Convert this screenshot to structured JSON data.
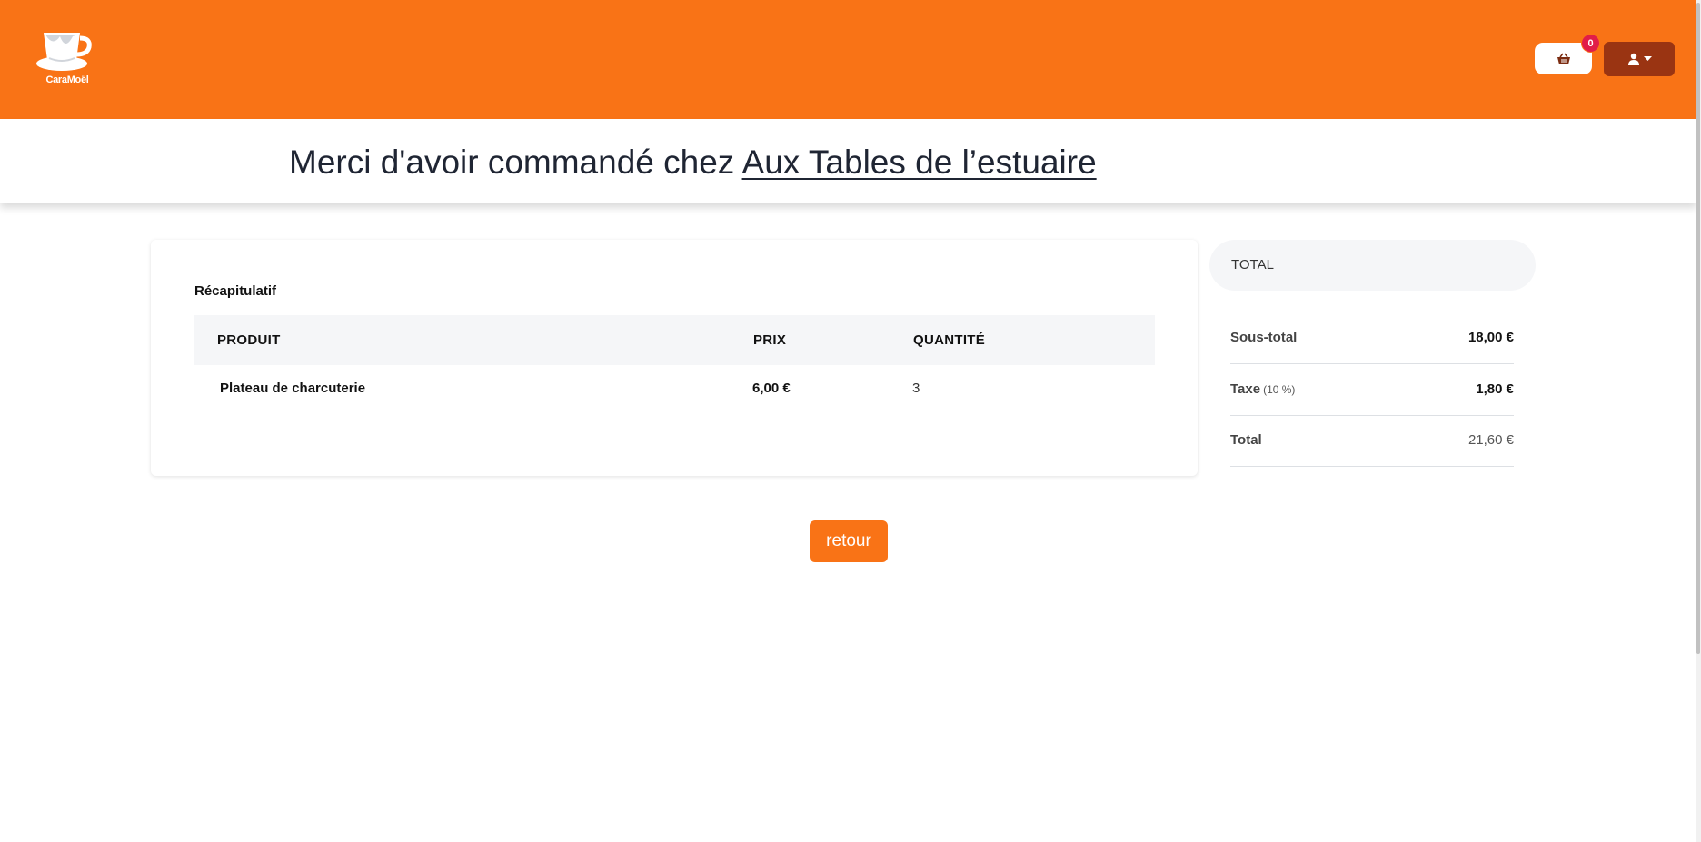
{
  "header": {
    "logo_text": "CaraMoël",
    "cart_count": "0",
    "cart_icon": "basket-icon",
    "user_icon": "user-icon",
    "colors": {
      "brand": "#f97316",
      "user_button": "#9a3412",
      "badge": "#e11d48"
    }
  },
  "title": {
    "prefix": "Merci d'avoir commandé chez ",
    "restaurant": "Aux Tables de l’estuaire"
  },
  "summary": {
    "heading": "Récapitulatif",
    "columns": [
      "PRODUIT",
      "PRIX",
      "QUANTITÉ"
    ],
    "rows": [
      {
        "product": "Plateau de charcuterie",
        "price": "6,00 €",
        "quantity": "3"
      }
    ]
  },
  "totals": {
    "header": "TOTAL",
    "subtotal_label": "Sous-total",
    "subtotal_value": "18,00 €",
    "tax_label": "Taxe",
    "tax_note": "(10 %)",
    "tax_value": "1,80 €",
    "total_label": "Total",
    "total_value": "21,60 €"
  },
  "actions": {
    "back_label": "retour"
  }
}
